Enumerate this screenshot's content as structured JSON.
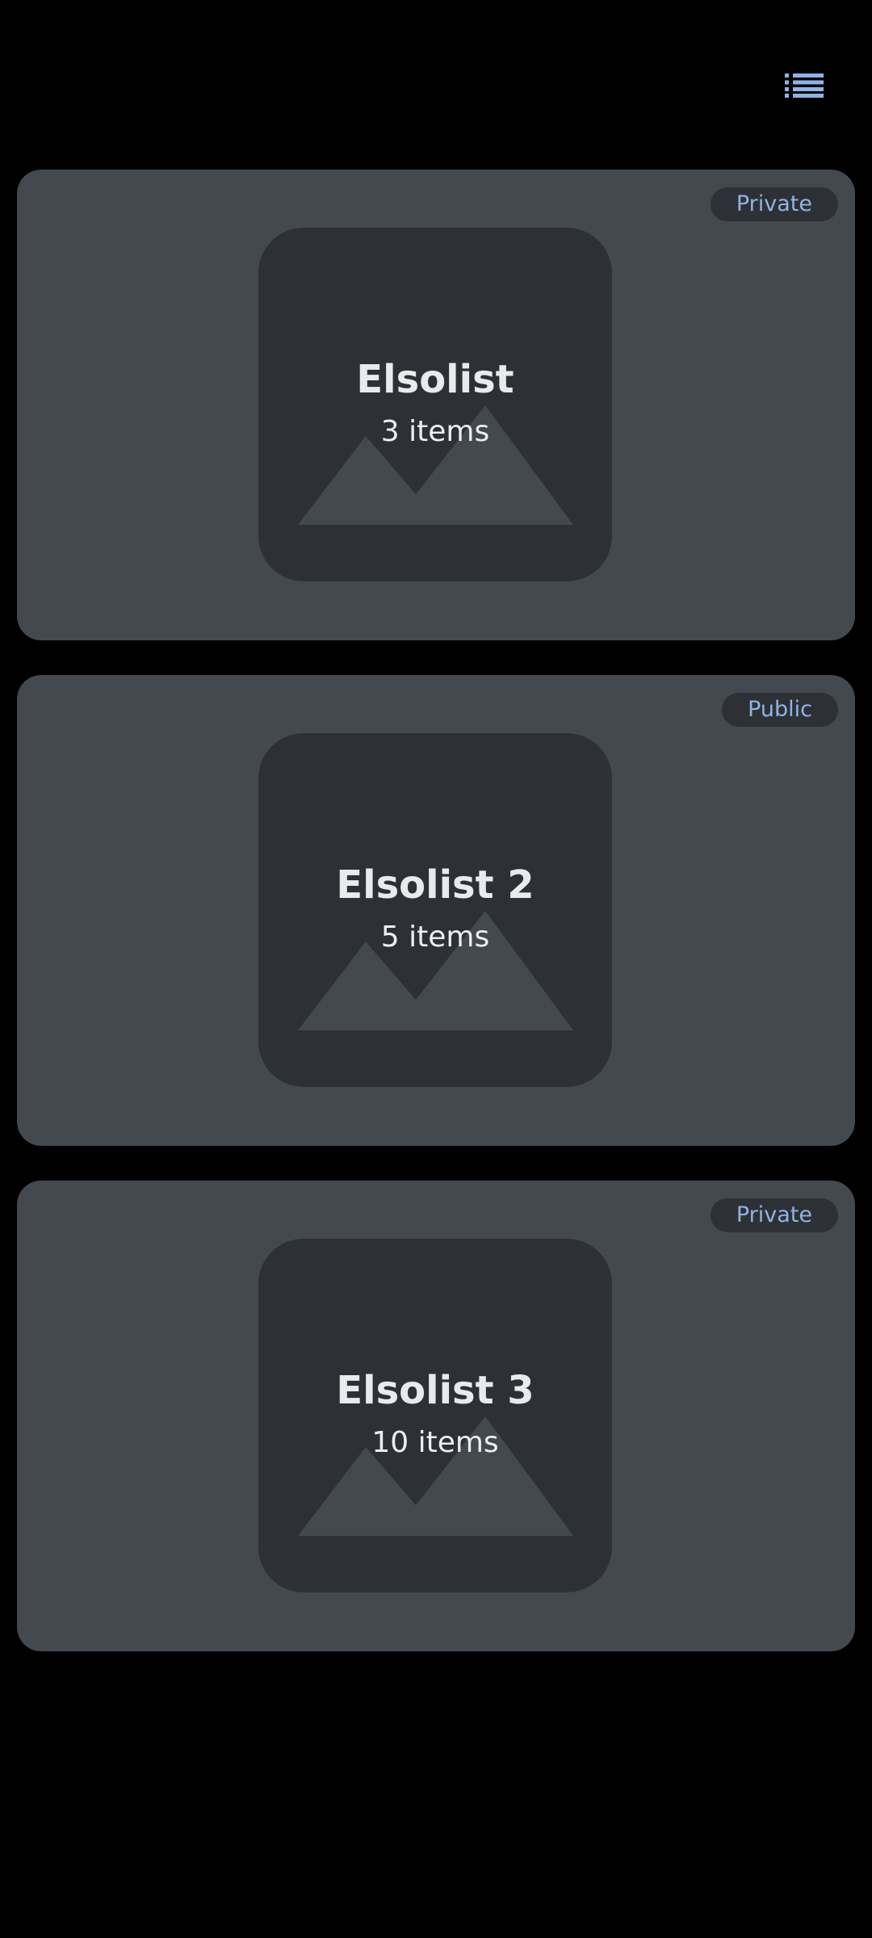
{
  "header": {
    "view_toggle_icon": "list-icon"
  },
  "colors": {
    "background": "#000000",
    "card": "#44484f",
    "thumbnail": "#2d3135",
    "badge_background": "#2d3136",
    "badge_text": "#8fb3e3",
    "accent": "#8fb3e3",
    "title_text": "#e8eaed"
  },
  "lists": [
    {
      "title": "Elsolist",
      "count": "3 items",
      "visibility": "Private",
      "thumbnail_icon": "image-placeholder-icon"
    },
    {
      "title": "Elsolist 2",
      "count": "5 items",
      "visibility": "Public",
      "thumbnail_icon": "image-placeholder-icon"
    },
    {
      "title": "Elsolist 3",
      "count": "10 items",
      "visibility": "Private",
      "thumbnail_icon": "image-placeholder-icon"
    }
  ]
}
